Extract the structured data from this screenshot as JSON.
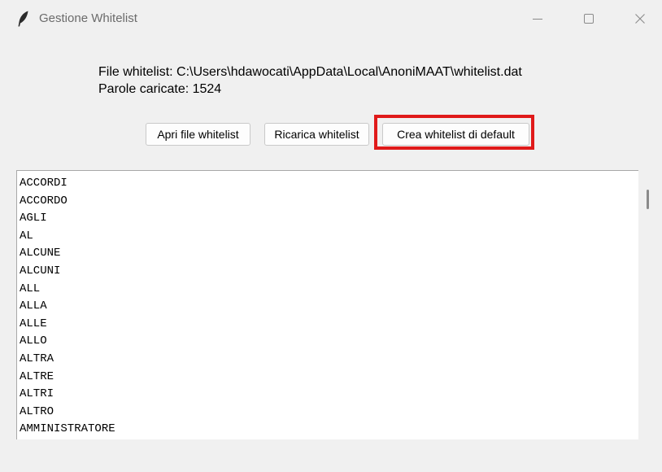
{
  "window": {
    "title": "Gestione Whitelist"
  },
  "info": {
    "file_line": "File whitelist: C:\\Users\\hdawocati\\AppData\\Local\\AnoniMAAT\\whitelist.dat",
    "count_line": "Parole caricate: 1524"
  },
  "buttons": {
    "open_label": "Apri file whitelist",
    "reload_label": "Ricarica whitelist",
    "default_label": "Crea whitelist di default"
  },
  "highlight_color": "#e01a1a",
  "words": [
    "ACCORDI",
    "ACCORDO",
    "AGLI",
    "AL",
    "ALCUNE",
    "ALCUNI",
    "ALL",
    "ALLA",
    "ALLE",
    "ALLO",
    "ALTRA",
    "ALTRE",
    "ALTRI",
    "ALTRO",
    "AMMINISTRATORE"
  ]
}
